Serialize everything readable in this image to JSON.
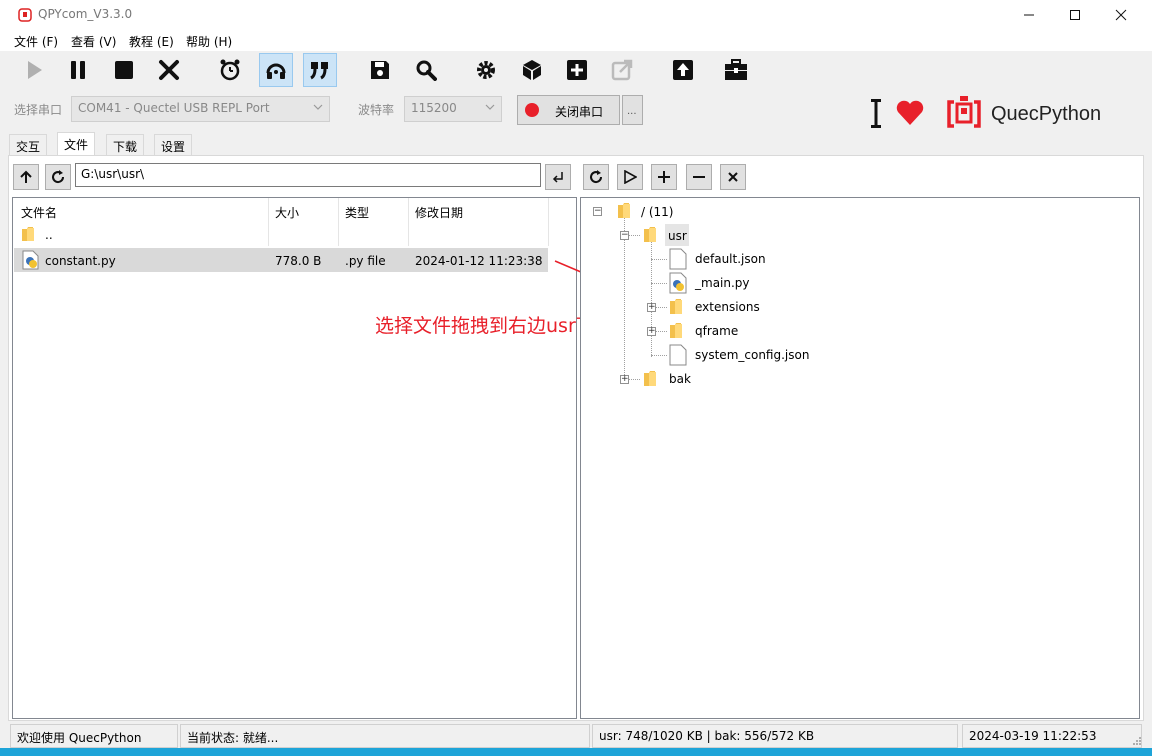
{
  "window": {
    "title": "QPYcom_V3.3.0"
  },
  "menu": [
    "文件 (F)",
    "查看 (V)",
    "教程 (E)",
    "帮助 (H)"
  ],
  "toolbar": {
    "icons": [
      "play-icon",
      "pause-icon",
      "stop-icon",
      "close-icon",
      "alarm-clock-icon",
      "headset-icon",
      "quote-icon",
      "save-icon",
      "search-icon",
      "gear-icon",
      "cube-icon",
      "add-square-icon",
      "external-link-icon",
      "upload-icon",
      "toolbox-icon"
    ]
  },
  "port": {
    "label": "选择串口",
    "value": "COM41 - Quectel USB REPL Port",
    "baud_label": "波特率",
    "baud_value": "115200",
    "toggle_label": "关闭串口",
    "more_label": "..."
  },
  "brand": {
    "text": "QuecPython",
    "accent": "#e8202a"
  },
  "tabs": [
    "交互",
    "文件",
    "下载",
    "设置"
  ],
  "local": {
    "path": "G:\\usr\\usr\\",
    "columns": [
      "文件名",
      "大小",
      "类型",
      "修改日期"
    ],
    "rows": [
      {
        "name": "..",
        "size": "",
        "type": "",
        "date": ""
      },
      {
        "name": "constant.py",
        "size": "778.0 B",
        "type": ".py file",
        "date": "2024-01-12 11:23:38"
      }
    ]
  },
  "annotation": "选择文件拖拽到右边usr下",
  "remote": {
    "root": "/ (11)",
    "usr": "usr",
    "usr_children": [
      "default.json",
      "_main.py",
      "extensions",
      "qframe",
      "system_config.json"
    ],
    "bak": "bak"
  },
  "status": {
    "welcome": "欢迎使用 QuecPython",
    "state": "当前状态: 就绪...",
    "storage": "usr: 748/1020 KB | bak: 556/572 KB",
    "time": "2024-03-19 11:22:53"
  }
}
